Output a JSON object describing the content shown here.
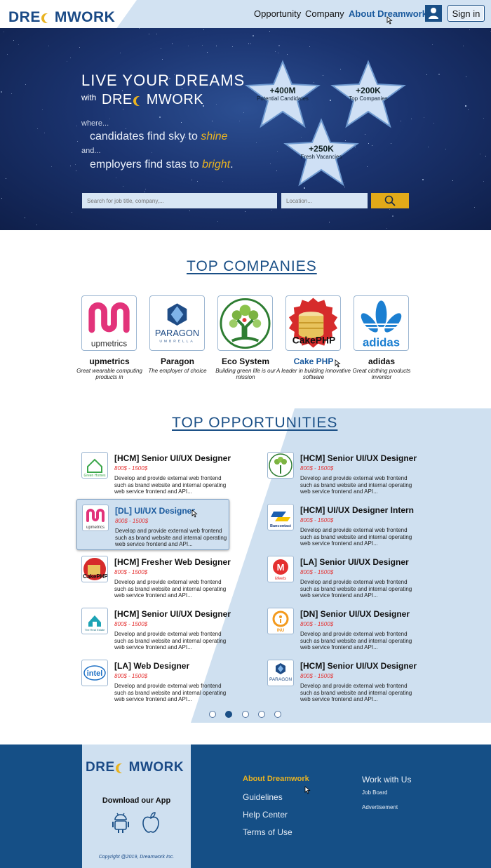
{
  "header": {
    "logo_left": "DRE",
    "logo_right": "MWORK",
    "nav": [
      "Opportunity",
      "Company",
      "About Dreamwork"
    ],
    "signin_label": "Sign in"
  },
  "hero": {
    "title": "LIVE YOUR DREAMS",
    "with": "with",
    "logo_left": "DRE",
    "logo_right": "MWORK",
    "where": "where...",
    "line1_prefix": "candidates find sky to",
    "line1_emph": "shine",
    "and": "and...",
    "line2_prefix": "employers find stas to",
    "line2_emph": "bright",
    "line2_suffix": ".",
    "stats": [
      {
        "value": "+400M",
        "label": "Potential Candidates"
      },
      {
        "value": "+200K",
        "label": "Top Companies"
      },
      {
        "value": "+250K",
        "label": "Fresh Vacancies"
      }
    ],
    "search_placeholder": "Search for job title, company,...",
    "location_placeholder": "Location..."
  },
  "companies": {
    "title": "TOP COMPANIES",
    "items": [
      {
        "name": "upmetrics",
        "desc": "Great wearable computing products in",
        "logo_text": "upmetrics"
      },
      {
        "name": "Paragon",
        "desc": "The employer of choice",
        "logo_text": "PARAGON",
        "logo_sub": "UMBRELLA"
      },
      {
        "name": "Eco System",
        "desc": "Building green life is our mission"
      },
      {
        "name": "Cake PHP",
        "desc": "A leader in building innovative software",
        "logo_text": "CakePHP"
      },
      {
        "name": "adidas",
        "desc": "Great clothing products inventor",
        "logo_text": "adidas"
      }
    ]
  },
  "opportunities": {
    "title": "TOP OPPORTUNITIES",
    "jobs": [
      {
        "title": "[HCM] Senior UI/UX Designer",
        "salary": "800$ - 1500$",
        "desc": "Develop and provide external web frontend such as brand website and internal operating web service frontend and API...",
        "logo": "Green Homes"
      },
      {
        "title": "[HCM] Senior UI/UX Designer",
        "salary": "800$ - 1500$",
        "desc": "Develop and provide external web frontend such as brand website and internal operating web service frontend and API...",
        "logo": "tree"
      },
      {
        "title": "[DL] UI/UX Designer",
        "salary": "800$ - 1500$",
        "desc": "Develop and provide external web frontend such as brand website and internal operating web service frontend and API...",
        "logo": "upmetrics"
      },
      {
        "title": "[HCM] UI/UX Designer Intern",
        "salary": "800$ - 1500$",
        "desc": "Develop and provide external web frontend such as brand website and internal operating web service frontend and API...",
        "logo": "Bancontact"
      },
      {
        "title": "[HCM] Fresher Web Designer",
        "salary": "800$ - 1500$",
        "desc": "Develop and provide external web frontend such as brand website and internal operating web service frontend and API...",
        "logo": "CakePHP"
      },
      {
        "title": "[LA] Senior UI/UX Designer",
        "salary": "800$ - 1500$",
        "desc": "Develop and provide external web frontend such as brand website and internal operating web service frontend and API...",
        "logo": "Meets"
      },
      {
        "title": "[HCM] Senior UI/UX Designer",
        "salary": "800$ - 1500$",
        "desc": "Develop and provide external web frontend such as brand website and internal operating web service frontend and API...",
        "logo": "The Real Estate"
      },
      {
        "title": "[DN] Senior UI/UX Designer",
        "salary": "800$ - 1500$",
        "desc": "Develop and provide external web frontend such as brand website and internal operating web service frontend and API...",
        "logo": "INU"
      },
      {
        "title": "[LA] Web Designer",
        "salary": "800$ - 1500$",
        "desc": "Develop and provide external web frontend such as brand website and internal operating web service frontend and API...",
        "logo": "intel"
      },
      {
        "title": "[HCM] Senior UI/UX Designer",
        "salary": "800$ - 1500$",
        "desc": "Develop and provide external web frontend such as brand website and internal operating web service frontend and API...",
        "logo": "PARAGON"
      }
    ],
    "pages": 5,
    "current_page": 2
  },
  "footer": {
    "logo_left": "DRE",
    "logo_right": "MWORK",
    "download": "Download our App",
    "copyright": "Copyright @2019, Dreamwork Inc.",
    "links": [
      "About Dreamwork",
      "Guidelines",
      "Help Center",
      "Terms of Use"
    ],
    "work_title": "Work with Us",
    "work_links": [
      "Job Board",
      "Advertisement"
    ]
  },
  "colors": {
    "brand": "#1a4f86",
    "accent": "#e9b321",
    "salary": "#e43030"
  }
}
